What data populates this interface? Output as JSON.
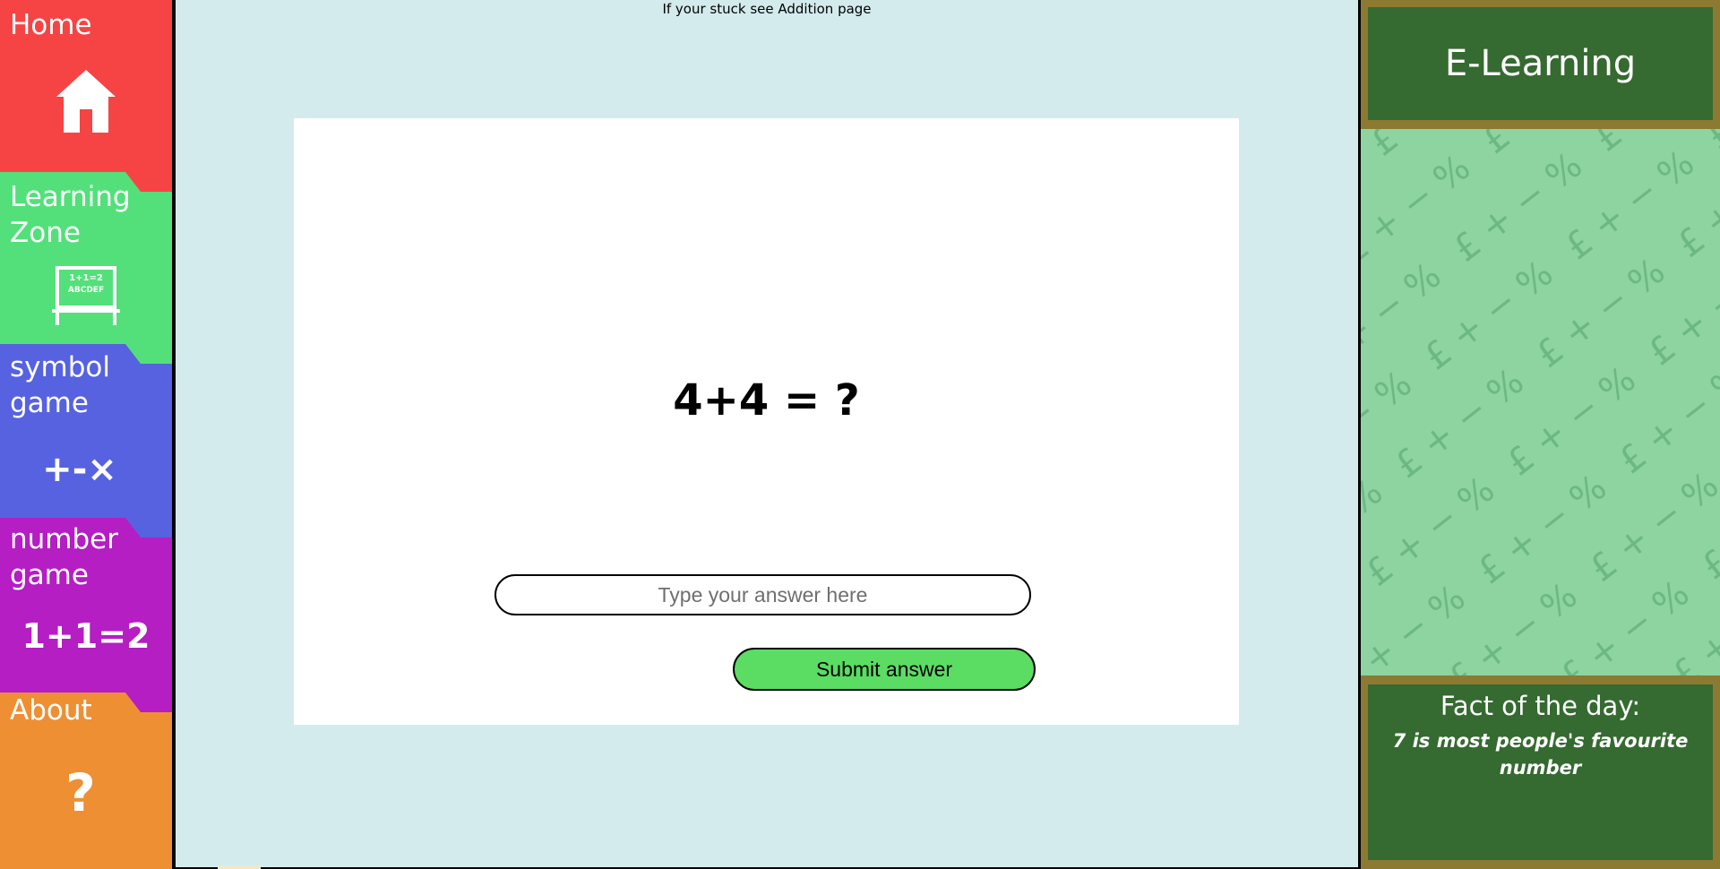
{
  "sidebar": {
    "items": [
      {
        "label": "Home",
        "icon": "house-icon",
        "color": "#f64444"
      },
      {
        "label": "Learning Zone",
        "icon": "chalkboard-icon",
        "icon_text_line1": "1+1=2",
        "icon_text_line2": "ABCDEF",
        "color": "#53e07a"
      },
      {
        "label": "symbol game",
        "icon": "math-symbols-icon",
        "icon_text": "+-×",
        "color": "#5662df"
      },
      {
        "label": "number game",
        "icon": "equation-icon",
        "icon_text": "1+1=2",
        "color": "#b41ec3"
      },
      {
        "label": "About",
        "icon": "question-mark-icon",
        "icon_text": "?",
        "color": "#ee8f34"
      }
    ]
  },
  "main": {
    "hint": "If your stuck see Addition page",
    "question": "4+4 = ?",
    "answer_placeholder": "Type your answer here",
    "answer_value": "",
    "submit_label": "Submit answer",
    "background_color": "#d4ebee",
    "submit_color": "#5bdd63"
  },
  "right_panel": {
    "brand_title": "E-Learning",
    "pattern_symbols": "£ + − %",
    "fact_title": "Fact of the day:",
    "fact_text": "7 is most people's favourite number",
    "board_color": "#356a30",
    "frame_color": "#8c7a32",
    "pattern_color": "#8ed4a0"
  }
}
